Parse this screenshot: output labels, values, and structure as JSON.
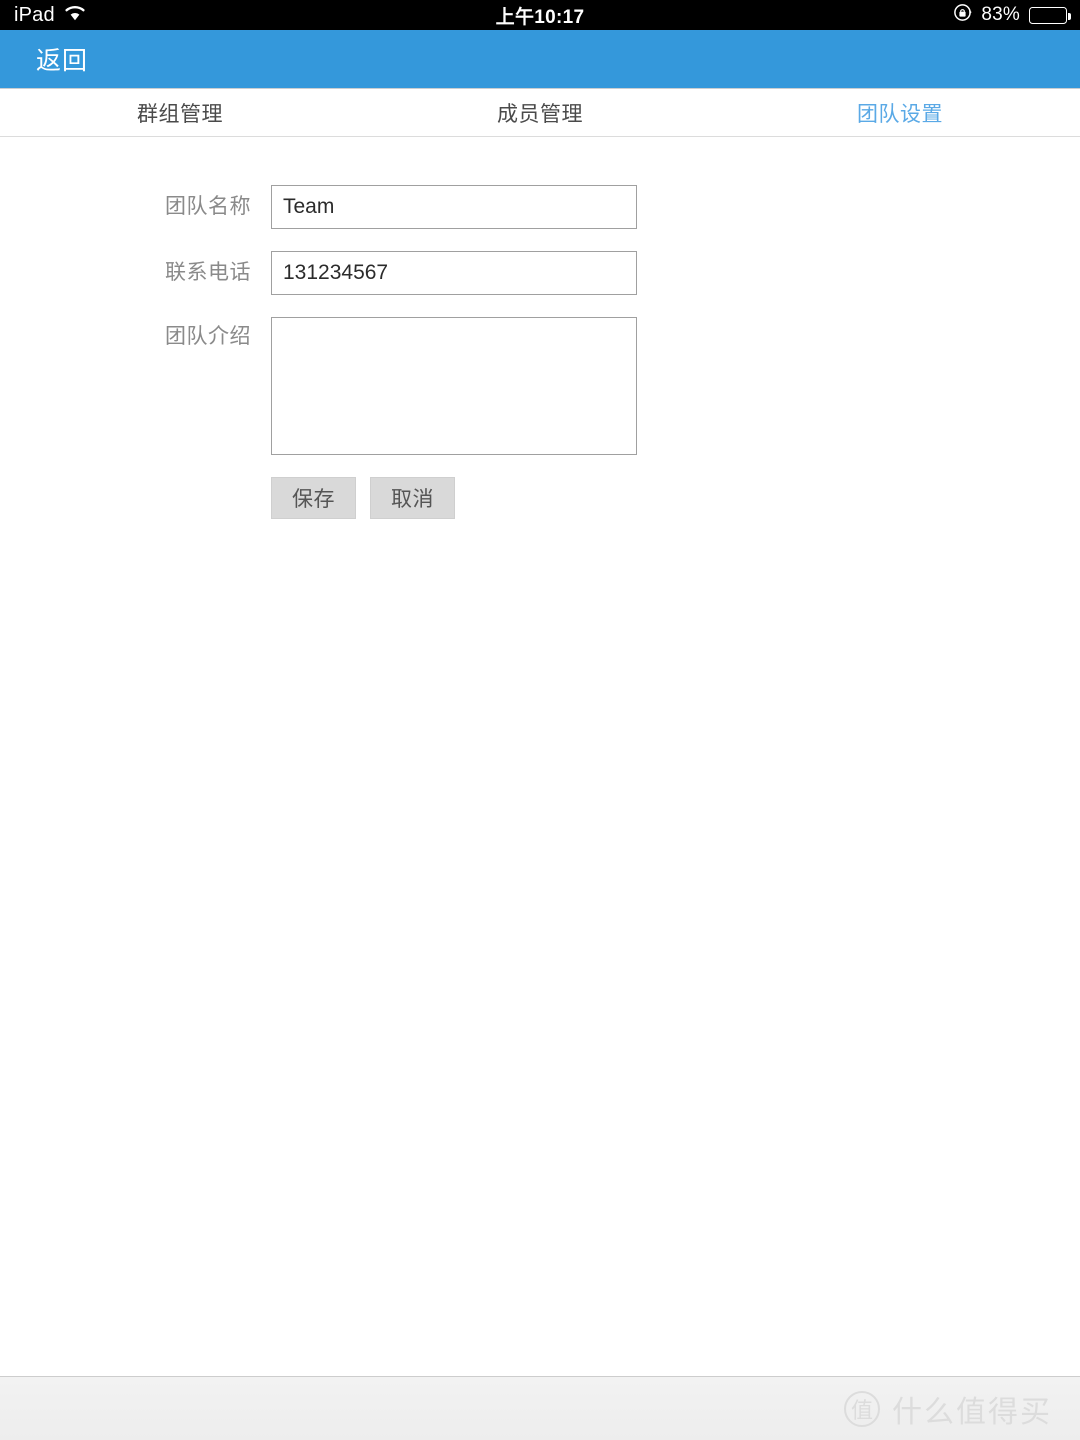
{
  "status_bar": {
    "device": "iPad",
    "wifi_icon": "wifi-icon",
    "time": "上午10:17",
    "rotation_lock_icon": "rotation-lock-icon",
    "battery_percent": "83%",
    "battery_level": 83
  },
  "nav": {
    "back_label": "返回",
    "background_color": "#3498db"
  },
  "tabs": [
    {
      "label": "群组管理",
      "active": false
    },
    {
      "label": "成员管理",
      "active": false
    },
    {
      "label": "团队设置",
      "active": true
    }
  ],
  "tab_active_color": "#5aa9e6",
  "form": {
    "fields": [
      {
        "label": "团队名称",
        "value": "Team",
        "placeholder": "",
        "type": "text"
      },
      {
        "label": "联系电话",
        "value": "131234567",
        "placeholder": "",
        "type": "text"
      },
      {
        "label": "团队介绍",
        "value": "",
        "placeholder": "",
        "type": "textarea"
      }
    ],
    "save_label": "保存",
    "cancel_label": "取消"
  },
  "footer": {
    "watermark_logo_text": "值",
    "watermark_text": "什么值得买"
  }
}
